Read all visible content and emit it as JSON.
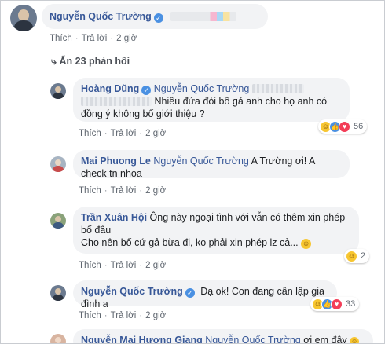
{
  "comments": [
    {
      "author": "Nguyễn Quốc Trường",
      "verified": true,
      "actions": [
        "Thích",
        "Trả lời",
        "2 giờ"
      ]
    }
  ],
  "collapse_label": "Ẩn 23 phản hồi",
  "replies": [
    {
      "author": "Hoàng Dũng",
      "mention": "Nguyễn Quốc Trường",
      "text": "Nhiều đứa đòi bố gả anh cho họ anh có đồng ý không bố giới thiệu ?",
      "actions": [
        "Thích",
        "Trả lời",
        "2 giờ"
      ],
      "reaction_count": "56"
    },
    {
      "author": "Mai Phuong Le",
      "mention": "Nguyễn Quốc Trường",
      "text": "A Trường ơi! A check tn nhoa",
      "actions": [
        "Thích",
        "Trả lời",
        "2 giờ"
      ]
    },
    {
      "author": "Trần Xuân Hội",
      "text": "Ông này ngoại tình với vẫn có thêm xin phép bố đâu",
      "text2": "Cho nên bố cứ gả bừa đi, ko phải xin phép lz cả...",
      "actions": [
        "Thích",
        "Trả lời",
        "2 giờ"
      ],
      "reaction_count": "2"
    },
    {
      "author": "Nguyễn Quốc Trường",
      "verified": true,
      "text": "Dạ ok! Con đang cần lập gia đình a",
      "actions": [
        "Thích",
        "Trả lời",
        "2 giờ"
      ],
      "reaction_count": "33"
    },
    {
      "author": "Nguyễn Mai Hương Giang",
      "mention": "Nguyễn Quốc Trường",
      "text": "ơi em đây"
    }
  ]
}
